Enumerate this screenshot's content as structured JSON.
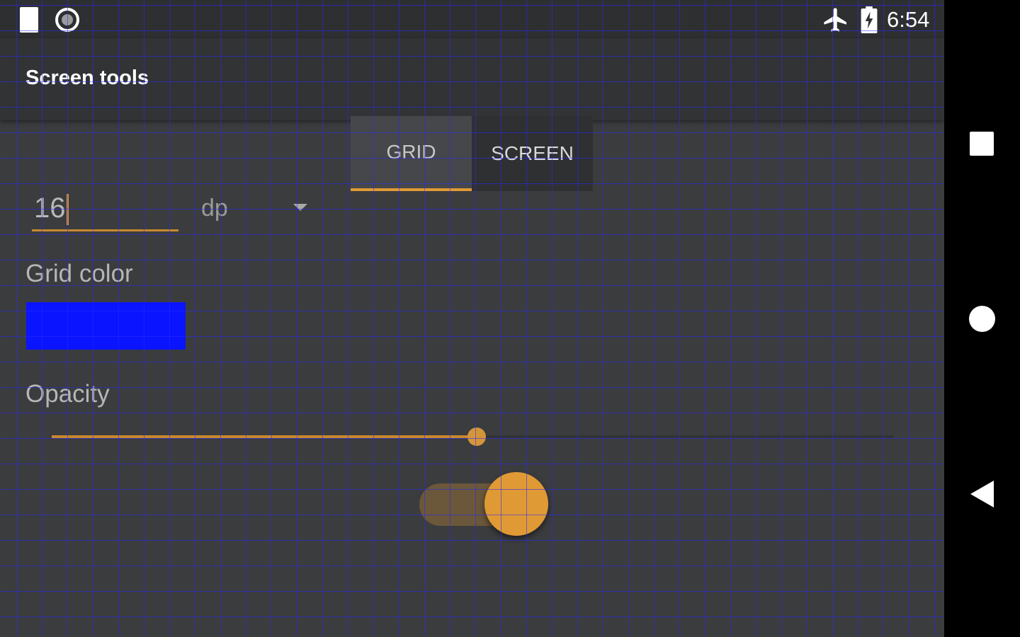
{
  "status_bar": {
    "time": "6:54",
    "icons": [
      "sim-card-icon",
      "screen-record-icon",
      "airplane-mode-icon",
      "battery-charging-icon"
    ]
  },
  "app_bar": {
    "title": "Screen tools"
  },
  "tabs": [
    {
      "label": "GRID",
      "selected": true
    },
    {
      "label": "SCREEN",
      "selected": false
    }
  ],
  "grid_settings": {
    "size_value": "16",
    "unit_value": "dp",
    "grid_color_label": "Grid color",
    "grid_color": "#0a14ff",
    "opacity_label": "Opacity",
    "opacity_fraction": 0.505,
    "grid_enabled": true
  },
  "colors": {
    "accent": "#e09a35",
    "background": "#3b3c3e",
    "app_bar": "#323335",
    "grid_line": "#2828ff"
  },
  "nav_bar": {
    "icons": [
      "recents-icon",
      "home-icon",
      "back-icon"
    ]
  }
}
